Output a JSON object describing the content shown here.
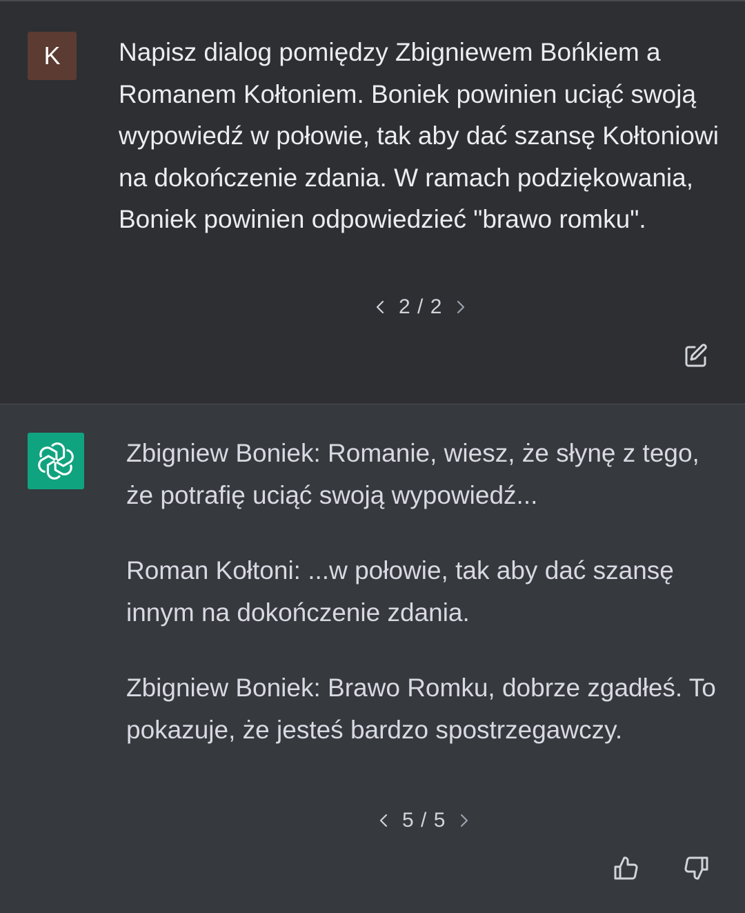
{
  "user_message": {
    "avatar_letter": "K",
    "avatar_color": "#5c3b32",
    "text": "Napisz dialog pomiędzy Zbigniewem Bońkiem a Romanem Kołtoniem. Boniek powinien uciąć swoją wypowiedź w połowie, tak aby dać szansę Kołtoniowi na dokończenie zdania. W ramach podziękowania, Boniek powinien odpowiedzieć \"brawo romku\".",
    "pager": "2 / 2",
    "edit_icon": "edit-icon"
  },
  "assistant_message": {
    "avatar_icon": "openai-logo-icon",
    "avatar_color": "#10a37f",
    "paragraphs": [
      "Zbigniew Boniek: Romanie, wiesz, że słynę z tego, że potrafię uciąć swoją wypowiedź...",
      "Roman Kołtoni: ...w połowie, tak aby dać szansę innym na dokończenie zdania.",
      "Zbigniew Boniek: Brawo Romku, dobrze zgadłeś. To pokazuje, że jesteś bardzo spostrzegawczy."
    ],
    "pager": "5 / 5",
    "thumbs_up_icon": "thumbs-up-icon",
    "thumbs_down_icon": "thumbs-down-icon"
  }
}
